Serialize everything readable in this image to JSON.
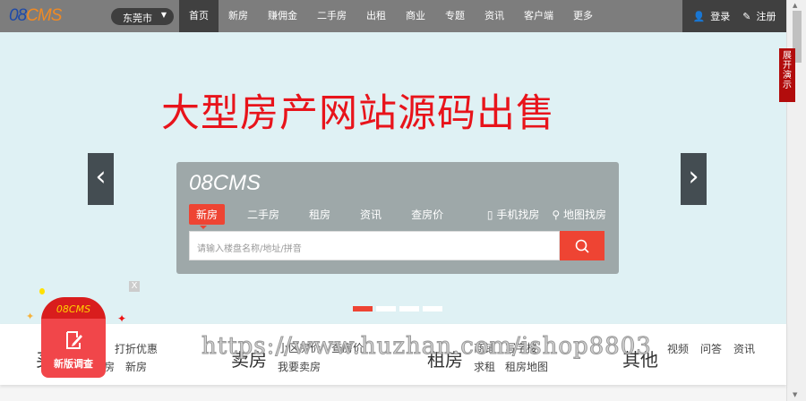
{
  "nav": {
    "logo_a": "08",
    "logo_b": "CMS",
    "city": "东莞市",
    "menu": [
      "首页",
      "新房",
      "赚佣金",
      "二手房",
      "出租",
      "商业",
      "专题",
      "资讯",
      "客户端",
      "更多"
    ],
    "login": "登录",
    "register": "注册"
  },
  "banner": {
    "headline": "大型房产网站源码出售",
    "demo": "展开演示",
    "prev": "‹",
    "next": "›"
  },
  "search": {
    "logo": "08CMS",
    "tabs": [
      "新房",
      "二手房",
      "租房",
      "资讯",
      "查房价"
    ],
    "mobile": "手机找房",
    "map": "地图找房",
    "placeholder": "请输入楼盘名称/地址/拼音"
  },
  "categories": [
    {
      "title": "买房",
      "items": [
        "打折优惠",
        "房",
        "新房"
      ]
    },
    {
      "title": "卖房",
      "items": [
        "小区房价",
        "查房价",
        "我要卖房"
      ]
    },
    {
      "title": "租房",
      "items": [
        "商铺",
        "写字楼",
        "求租",
        "租房地图"
      ]
    },
    {
      "title": "其他",
      "items": [
        "视频",
        "问答",
        "资讯"
      ]
    }
  ],
  "watermark": "https://www.huzhan.com/ishop8803",
  "survey": {
    "logo": "08CMS",
    "label": "新版调查",
    "close": "X"
  }
}
